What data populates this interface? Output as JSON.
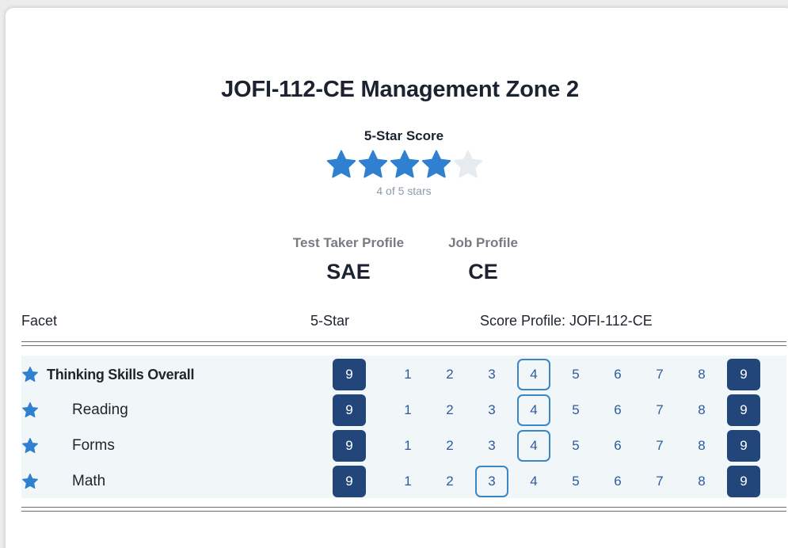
{
  "title": "JOFI-112-CE Management Zone 2",
  "score": {
    "label": "5-Star Score",
    "stars_filled": 4,
    "stars_total": 5,
    "caption": "4 of 5 stars",
    "filled_color": "#2f80d0",
    "empty_color": "#e6ebf0"
  },
  "profiles": {
    "test_taker": {
      "label": "Test Taker Profile",
      "value": "SAE"
    },
    "job": {
      "label": "Job Profile",
      "value": "CE"
    }
  },
  "table": {
    "headers": {
      "facet": "Facet",
      "five_star": "5-Star",
      "score_profile": "Score Profile: JOFI-112-CE"
    },
    "scale": [
      "1",
      "2",
      "3",
      "4",
      "5",
      "6",
      "7",
      "8"
    ],
    "rows": [
      {
        "facet": "Thinking Skills Overall",
        "five_star": "9",
        "highlight": "4",
        "end": "9",
        "icon": "star-icon"
      },
      {
        "facet": "Reading",
        "five_star": "9",
        "highlight": "4",
        "end": "9",
        "icon": "star-icon"
      },
      {
        "facet": "Forms",
        "five_star": "9",
        "highlight": "4",
        "end": "9",
        "icon": "star-icon"
      },
      {
        "facet": "Math",
        "five_star": "9",
        "highlight": "3",
        "end": "9",
        "icon": "star-icon"
      }
    ]
  },
  "colors": {
    "accent": "#2f80d0",
    "dark_box": "#22467a",
    "scale_text": "#2d5aa0",
    "row_bg": "#f1f7f8"
  }
}
